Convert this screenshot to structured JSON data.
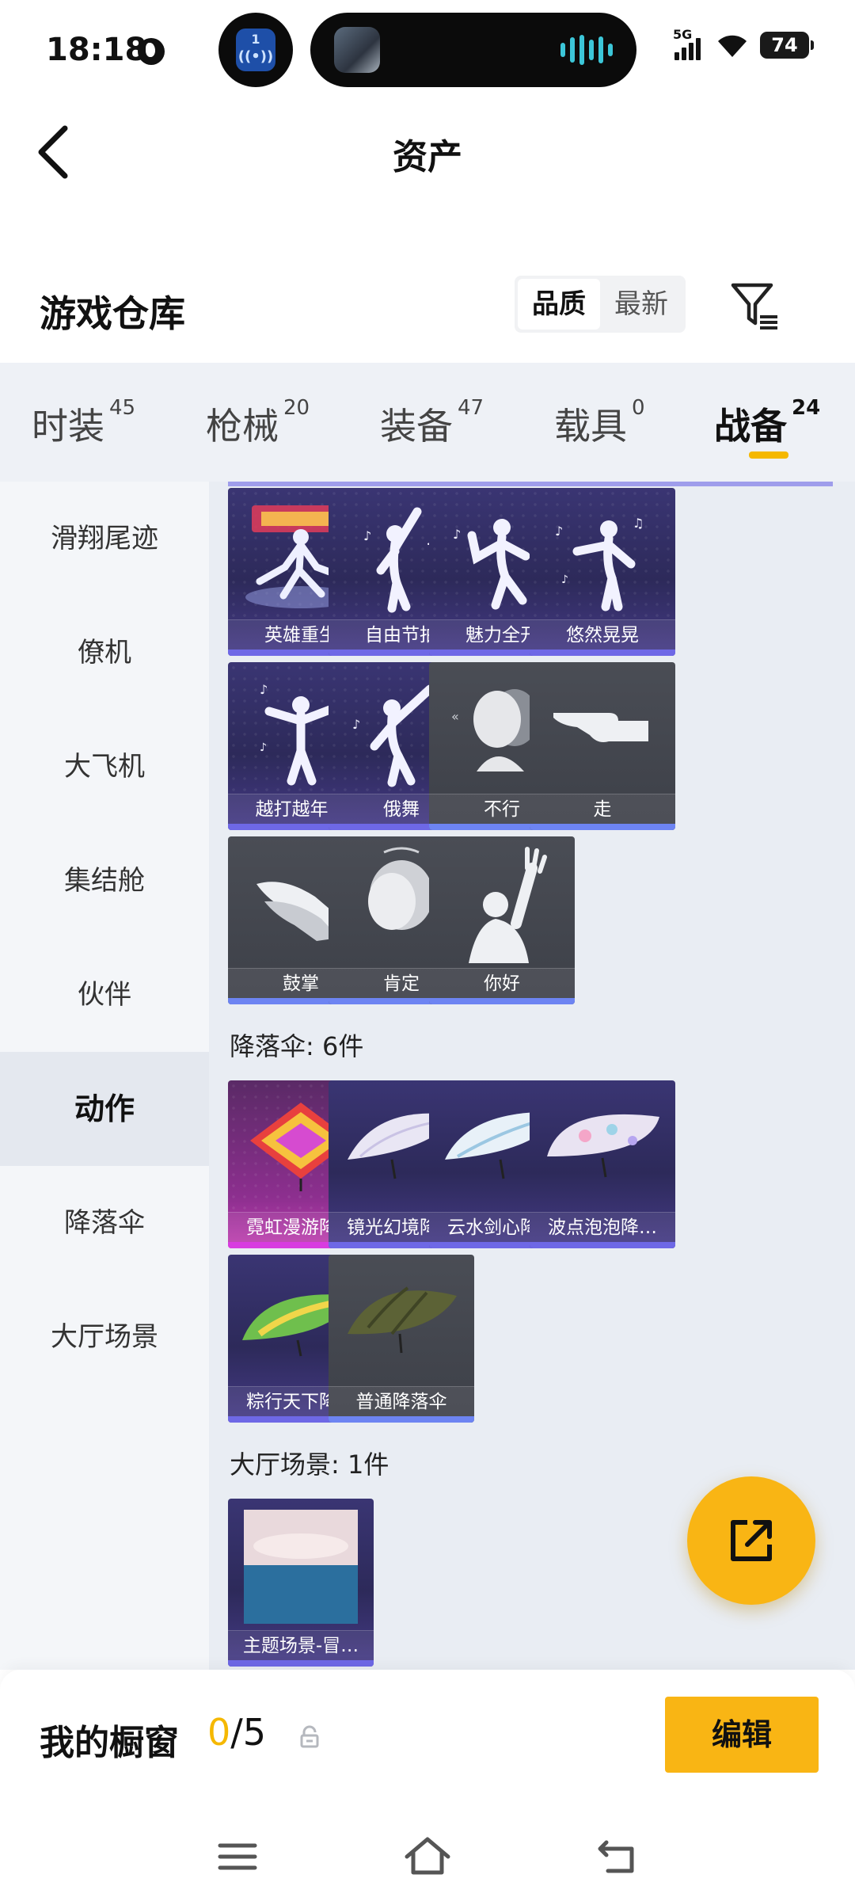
{
  "status": {
    "time": "18:18",
    "island_badge": "1",
    "network": "5G",
    "battery": "74"
  },
  "header": {
    "title": "资产"
  },
  "warehouse": {
    "title": "游戏仓库",
    "sort_options": [
      "品质",
      "最新"
    ],
    "sort_selected": "品质"
  },
  "category_tabs": [
    {
      "label": "时装",
      "count": "45"
    },
    {
      "label": "枪械",
      "count": "20"
    },
    {
      "label": "装备",
      "count": "47"
    },
    {
      "label": "载具",
      "count": "0"
    },
    {
      "label": "战备",
      "count": "24"
    }
  ],
  "active_tab": "战备",
  "sidebar": {
    "items": [
      "滑翔尾迹",
      "僚机",
      "大飞机",
      "集结舱",
      "伙伴",
      "动作",
      "降落伞",
      "大厅场景"
    ],
    "active": "动作"
  },
  "emotes": [
    {
      "name": "英雄重生",
      "art": "hero-pose-icon",
      "rarity": "purple"
    },
    {
      "name": "自由节拍",
      "art": "dance-pose-icon",
      "rarity": "purple"
    },
    {
      "name": "魅力全开",
      "art": "dance-pose-icon",
      "rarity": "purple"
    },
    {
      "name": "悠然晃晃",
      "art": "dance-pose-icon",
      "rarity": "purple"
    },
    {
      "name": "越打越年轻",
      "art": "dance-pose-icon",
      "rarity": "purple"
    },
    {
      "name": "俄舞",
      "art": "dance-pose-icon",
      "rarity": "purple"
    },
    {
      "name": "不行",
      "art": "head-shake-icon",
      "rarity": "grey"
    },
    {
      "name": "走",
      "art": "pointing-hand-icon",
      "rarity": "grey"
    },
    {
      "name": "鼓掌",
      "art": "clapping-hands-icon",
      "rarity": "grey"
    },
    {
      "name": "肯定",
      "art": "head-nod-icon",
      "rarity": "grey"
    },
    {
      "name": "你好",
      "art": "waving-hand-icon",
      "rarity": "grey"
    }
  ],
  "parachute_section": {
    "title": "降落伞: 6件",
    "items": [
      {
        "name": "霓虹漫游降…",
        "art": "neon-parachute-icon",
        "rarity": "pink"
      },
      {
        "name": "镜光幻境降…",
        "art": "parachute-icon",
        "rarity": "purple"
      },
      {
        "name": "云水剑心降…",
        "art": "parachute-icon",
        "rarity": "purple"
      },
      {
        "name": "波点泡泡降…",
        "art": "parachute-icon",
        "rarity": "purple"
      },
      {
        "name": "粽行天下降…",
        "art": "parachute-icon",
        "rarity": "purple"
      },
      {
        "name": "普通降落伞",
        "art": "parachute-icon",
        "rarity": "grey"
      }
    ]
  },
  "lobby_section": {
    "title": "大厅场景: 1件",
    "items": [
      {
        "name": "主题场景-冒…",
        "art": "ocean-scene-icon",
        "rarity": "purple"
      }
    ]
  },
  "showcase": {
    "title": "我的橱窗",
    "current": "0",
    "total": "/5",
    "edit_label": "编辑"
  },
  "colors": {
    "accent": "#f9b514",
    "tab_bg": "#eef1f6",
    "purple_card": "#2d2a5a",
    "grey_card": "#3d4048",
    "pink_card": "#8d2f8f"
  }
}
